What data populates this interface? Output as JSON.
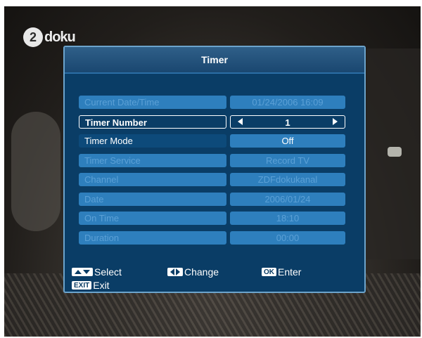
{
  "channel_logo": {
    "text": "doku",
    "circle": "2"
  },
  "dialog": {
    "title": "Timer",
    "rows": [
      {
        "label": "Current Date/Time",
        "value": "01/24/2006 16:09",
        "state": "disabled"
      },
      {
        "label": "Timer Number",
        "value": "1",
        "state": "active"
      },
      {
        "label": "Timer Mode",
        "value": "Off",
        "state": "enabled"
      },
      {
        "label": "Timer Service",
        "value": "Record TV",
        "state": "disabled"
      },
      {
        "label": "Channel",
        "value": "ZDFdokukanal",
        "state": "disabled"
      },
      {
        "label": "Date",
        "value": "2006/01/24",
        "state": "disabled"
      },
      {
        "label": "On Time",
        "value": "18:10",
        "state": "disabled"
      },
      {
        "label": "Duration",
        "value": "00:00",
        "state": "disabled"
      }
    ]
  },
  "footer": {
    "select_label": "Select",
    "change_label": "Change",
    "ok_key": "OK",
    "enter_label": "Enter",
    "exit_key": "EXIT",
    "exit_label": "Exit"
  },
  "colors": {
    "panel": "#0a3d66",
    "field": "#2e7fbd",
    "disabled_text": "#5ba0d6",
    "border": "#6ca4cc"
  }
}
